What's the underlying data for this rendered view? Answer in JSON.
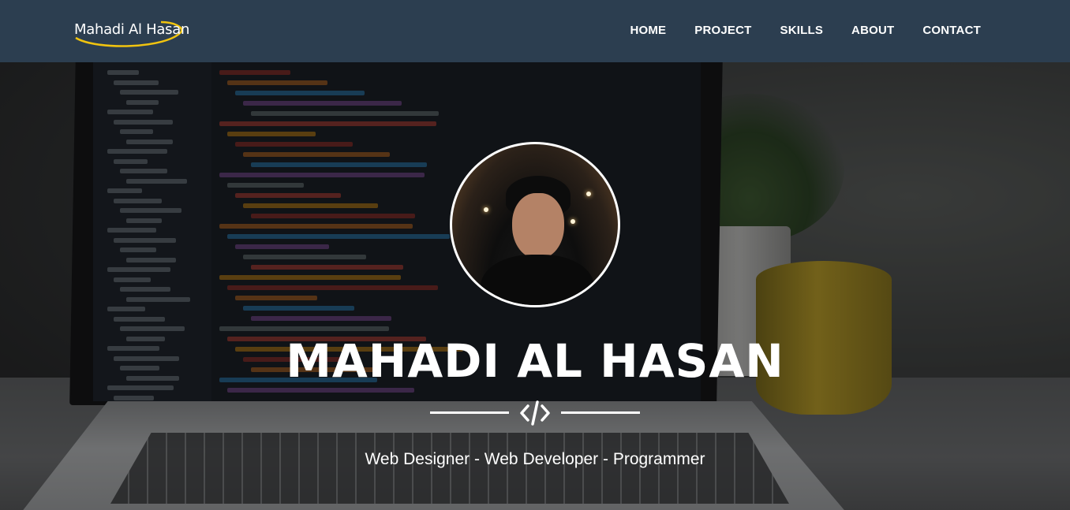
{
  "brand": {
    "logo_text": "Mahadi Al Hasan",
    "swoosh_color": "#f1c40f"
  },
  "nav": {
    "items": [
      {
        "label": "HOME"
      },
      {
        "label": "PROJECT"
      },
      {
        "label": "SKILLS"
      },
      {
        "label": "ABOUT"
      },
      {
        "label": "CONTACT"
      }
    ],
    "background": "#2c3e50"
  },
  "hero": {
    "name": "MAHADI AL HASAN",
    "divider_icon": "code-icon",
    "tagline": "Web Designer - Web Developer - Programmer",
    "avatar_icon": "profile-photo"
  }
}
